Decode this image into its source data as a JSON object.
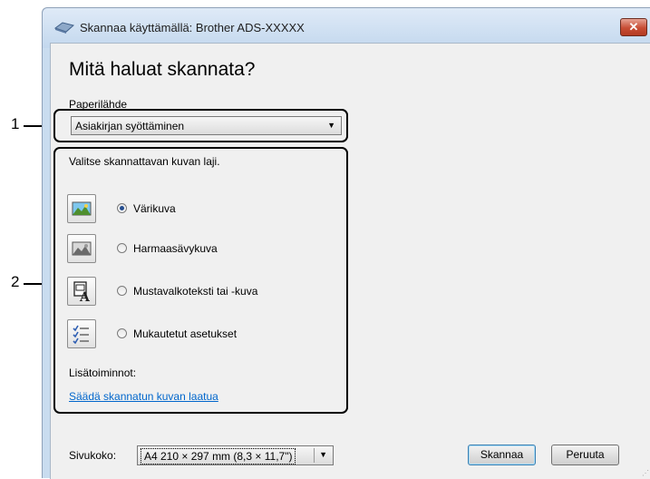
{
  "window": {
    "title": "Skannaa käyttämällä: Brother ADS-XXXXX",
    "close_label": "✕"
  },
  "heading": "Mitä haluat skannata?",
  "paper_source": {
    "label": "Paperilähde",
    "selected": "Asiakirjan syöttäminen"
  },
  "image_type_hint": "Valitse skannattavan kuvan laji.",
  "options": [
    {
      "label": "Värikuva",
      "selected": true,
      "icon": "color-photo-icon"
    },
    {
      "label": "Harmaasävykuva",
      "selected": false,
      "icon": "grayscale-photo-icon"
    },
    {
      "label": "Mustavalkoteksti tai -kuva",
      "selected": false,
      "icon": "bw-text-icon"
    },
    {
      "label": "Mukautetut asetukset",
      "selected": false,
      "icon": "custom-settings-icon"
    }
  ],
  "more_options_label": "Lisätoiminnot:",
  "adjust_quality_link": "Säädä skannatun kuvan laatua",
  "page_size": {
    "label": "Sivukoko:",
    "selected": "A4 210 × 297 mm (8,3 × 11,7\")"
  },
  "buttons": {
    "scan": "Skannaa",
    "cancel": "Peruuta"
  },
  "callouts": {
    "one": "1",
    "two": "2"
  },
  "colors": {
    "link": "#0066cc",
    "radio_dot": "#234c8e",
    "close_button": "#c74d34"
  }
}
